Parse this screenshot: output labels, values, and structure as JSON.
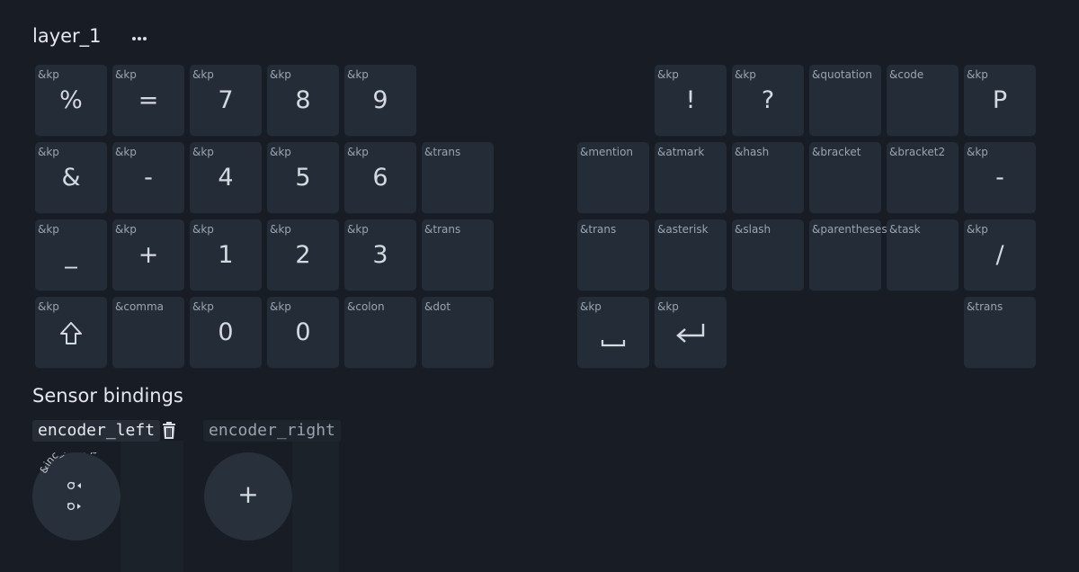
{
  "layer": {
    "title": "layer_1",
    "menu_icon": "more-horizontal-icon"
  },
  "keys": [
    {
      "binding": "&kp",
      "label": "%"
    },
    {
      "binding": "&kp",
      "label": "="
    },
    {
      "binding": "&kp",
      "label": "7"
    },
    {
      "binding": "&kp",
      "label": "8"
    },
    {
      "binding": "&kp",
      "label": "9"
    },
    {
      "binding": "&kp",
      "label": "!"
    },
    {
      "binding": "&kp",
      "label": "?"
    },
    {
      "binding": "&quotation",
      "label": ""
    },
    {
      "binding": "&code",
      "label": ""
    },
    {
      "binding": "&kp",
      "label": "P"
    },
    {
      "binding": "&kp",
      "label": "&"
    },
    {
      "binding": "&kp",
      "label": "-"
    },
    {
      "binding": "&kp",
      "label": "4"
    },
    {
      "binding": "&kp",
      "label": "5"
    },
    {
      "binding": "&kp",
      "label": "6"
    },
    {
      "binding": "&trans",
      "label": ""
    },
    {
      "binding": "&mention",
      "label": ""
    },
    {
      "binding": "&atmark",
      "label": ""
    },
    {
      "binding": "&hash",
      "label": ""
    },
    {
      "binding": "&bracket",
      "label": ""
    },
    {
      "binding": "&bracket2",
      "label": ""
    },
    {
      "binding": "&kp",
      "label": "-"
    },
    {
      "binding": "&kp",
      "label": "_"
    },
    {
      "binding": "&kp",
      "label": "+"
    },
    {
      "binding": "&kp",
      "label": "1"
    },
    {
      "binding": "&kp",
      "label": "2"
    },
    {
      "binding": "&kp",
      "label": "3"
    },
    {
      "binding": "&trans",
      "label": ""
    },
    {
      "binding": "&trans",
      "label": ""
    },
    {
      "binding": "&asterisk",
      "label": ""
    },
    {
      "binding": "&slash",
      "label": ""
    },
    {
      "binding": "&parentheses",
      "label": ""
    },
    {
      "binding": "&task",
      "label": ""
    },
    {
      "binding": "&kp",
      "label": "/"
    },
    {
      "binding": "&kp",
      "label": "",
      "icon": "shift-icon"
    },
    {
      "binding": "&comma",
      "label": ""
    },
    {
      "binding": "&kp",
      "label": "0"
    },
    {
      "binding": "&kp",
      "label": "0"
    },
    {
      "binding": "&colon",
      "label": ""
    },
    {
      "binding": "&dot",
      "label": ""
    },
    {
      "binding": "&kp",
      "label": "",
      "icon": "space-icon"
    },
    {
      "binding": "&kp",
      "label": "",
      "icon": "enter-icon"
    },
    {
      "binding": "&trans",
      "label": ""
    }
  ],
  "sensors": {
    "title": "Sensor bindings",
    "encoders": [
      {
        "name": "encoder_left",
        "binding": "&inc_dec_kp",
        "rotate_cw_icon": "rotate-cw-icon",
        "rotate_ccw_icon": "rotate-ccw-icon",
        "delete_icon": "trash-icon"
      },
      {
        "name": "encoder_right",
        "add_label": "+"
      }
    ]
  },
  "colors": {
    "background": "#181d25",
    "key": "#242d37",
    "binding_text": "#9aa4af",
    "label_text": "#d3d9e0"
  }
}
